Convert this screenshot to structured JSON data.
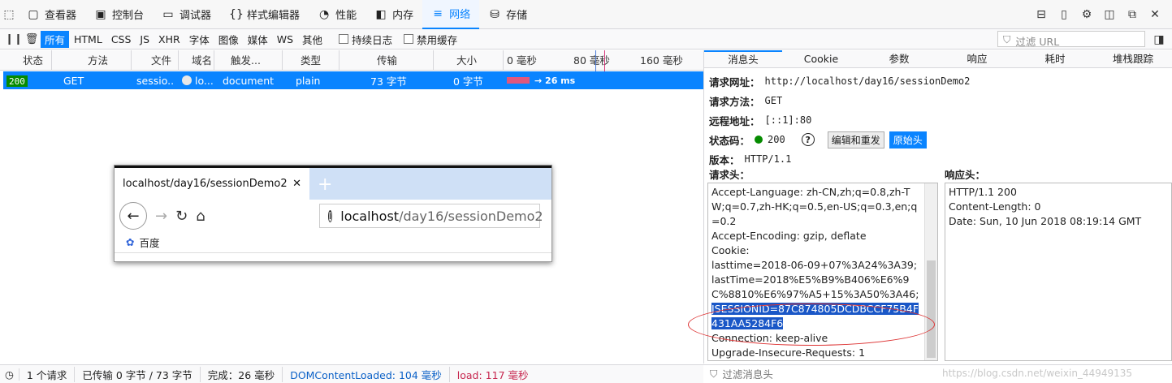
{
  "toolbar": {
    "tabs": [
      {
        "label": "查看器",
        "icon": "inspector-icon"
      },
      {
        "label": "控制台",
        "icon": "console-icon"
      },
      {
        "label": "调试器",
        "icon": "debugger-icon"
      },
      {
        "label": "样式编辑器",
        "icon": "style-editor-icon"
      },
      {
        "label": "性能",
        "icon": "performance-icon"
      },
      {
        "label": "内存",
        "icon": "memory-icon"
      },
      {
        "label": "网络",
        "icon": "network-icon"
      },
      {
        "label": "存储",
        "icon": "storage-icon"
      }
    ],
    "selected_tab": "网络"
  },
  "filters": {
    "types": [
      "所有",
      "HTML",
      "CSS",
      "JS",
      "XHR",
      "字体",
      "图像",
      "媒体",
      "WS",
      "其他"
    ],
    "active_type": "所有",
    "persist_logs": "持续日志",
    "disable_cache": "禁用缓存",
    "url_placeholder": "过滤 URL"
  },
  "columns": [
    "状态",
    "方法",
    "文件",
    "域名",
    "触发...",
    "类型",
    "传输",
    "大小",
    "0 毫秒",
    "80 毫秒",
    "160 毫秒"
  ],
  "request": {
    "status": "200",
    "method": "GET",
    "file": "sessio...",
    "domain": "lo...",
    "cause": "document",
    "type": "plain",
    "transferred": "73 字节",
    "size": "0 字节",
    "timing": "→ 26 ms"
  },
  "preview": {
    "tab_title": "localhost/day16/sessionDemo2",
    "url_host": "localhost",
    "url_path": "/day16/sessionDemo2",
    "bookmark": "百度"
  },
  "panel": {
    "tabs": [
      "消息头",
      "Cookie",
      "参数",
      "响应",
      "耗时",
      "堆栈跟踪"
    ],
    "selected_tab": "消息头",
    "request_url_label": "请求网址：",
    "request_url": "http://localhost/day16/sessionDemo2",
    "method_label": "请求方法：",
    "method": "GET",
    "remote_label": "远程地址：",
    "remote": "[::1]:80",
    "status_label": "状态码：",
    "status": "200",
    "edit_resend": "编辑和重发",
    "raw_headers": "原始头",
    "version_label": "版本：",
    "version": "HTTP/1.1",
    "req_headers_title": "请求头：",
    "res_headers_title": "响应头：",
    "request_headers": [
      "Accept-Language: zh-CN,zh;q=0.8,zh-TW;q=0.7,zh-HK;q=0.5,en-US;q=0.3,en;q=0.2",
      "Accept-Encoding: gzip, deflate",
      "Cookie:",
      "lasttime=2018-06-09+07%3A24%3A39;",
      "lastTime=2018%E5%B9%B406%E6%9C%8810%E6%97%A5+15%3A50%3A46;"
    ],
    "selected_header": "JSESSIONID=87C874805DCDBCCF75B4F431AA5284F6",
    "request_headers_after": [
      "Connection: keep-alive",
      "Upgrade-Insecure-Requests: 1"
    ],
    "response_headers": [
      "HTTP/1.1 200",
      "Content-Length: 0",
      "Date: Sun, 10 Jun 2018 08:19:14 GMT"
    ],
    "filter_placeholder": "过滤消息头"
  },
  "statusbar": {
    "requests": "1 个请求",
    "transferred": "已传输 0 字节 / 73 字节",
    "finish": "完成：26 毫秒",
    "dcl": "DOMContentLoaded: 104 毫秒",
    "load": "load: 117 毫秒"
  },
  "watermark": "https://blog.csdn.net/weixin_44949135",
  "colors": {
    "accent": "#0a84ff",
    "status_ok": "#058b00",
    "selection": "#1a57c7"
  }
}
